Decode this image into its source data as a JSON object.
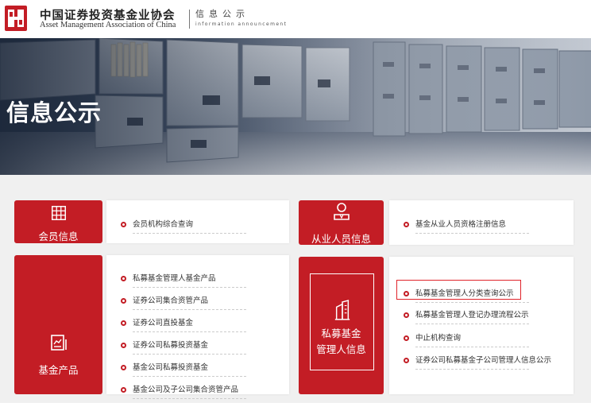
{
  "header": {
    "org_name_cn": "中国证券投资基金业协会",
    "org_name_en": "Asset Management Association of China",
    "section_cn": "信息公示",
    "section_en": "information announcement"
  },
  "banner": {
    "title": "信息公示"
  },
  "member_info": {
    "tile_label": "会员信息",
    "links": [
      "会员机构综合查询"
    ]
  },
  "practitioner_info": {
    "tile_label": "从业人员信息",
    "links": [
      "基金从业人员资格注册信息"
    ]
  },
  "fund_products": {
    "tile_label": "基金产品",
    "links": [
      "私募基金管理人基金产品",
      "证券公司集合资管产品",
      "证券公司直投基金",
      "证券公司私募投资基金",
      "基金公司私募投资基金",
      "基金公司及子公司集合资管产品"
    ]
  },
  "private_fund_manager": {
    "tile_label_line1": "私募基金",
    "tile_label_line2": "管理人信息",
    "links": [
      "私募基金管理人分类查询公示",
      "私募基金管理人登记办理流程公示",
      "中止机构查询",
      "证券公司私募基金子公司管理人信息公示"
    ],
    "highlighted_link": "私募基金管理人分类查询公示"
  },
  "colors": {
    "brand_red": "#c31d25",
    "highlight_border": "#e0242b"
  }
}
